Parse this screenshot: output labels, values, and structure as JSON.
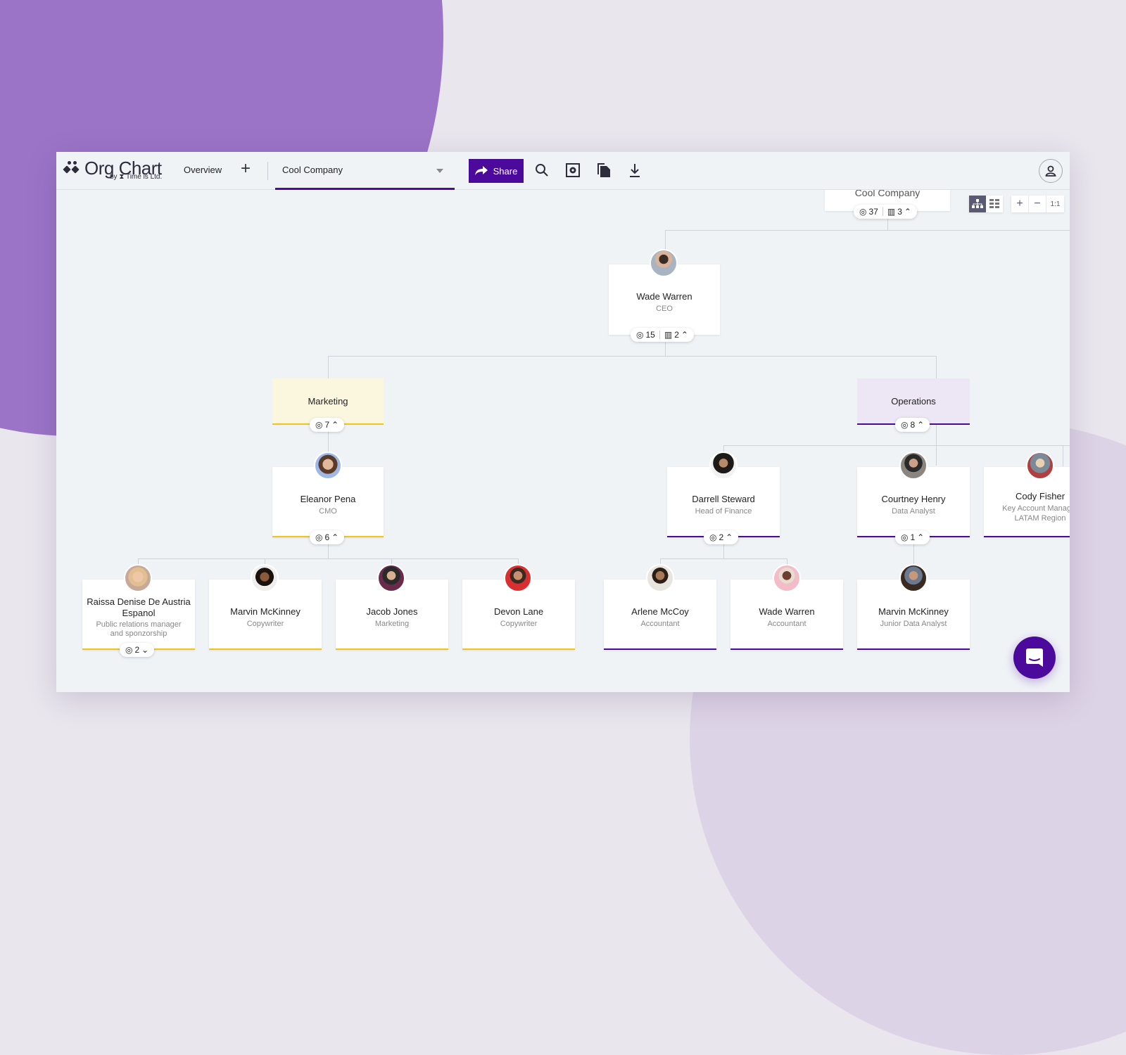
{
  "app": {
    "brand": "Org Chart",
    "brand_sub": "by ⧗ Time is Ltd.",
    "nav_overview": "Overview",
    "company_select": "Cool Company",
    "share_label": "Share",
    "zoom_reset": "1:1",
    "colors": {
      "accent": "#4b0a9c",
      "marketing": "#f0c419",
      "marketing_bg": "#fbf7df",
      "operations_bg": "#ece6f5"
    }
  },
  "root": {
    "name": "Cool Company",
    "people": "37",
    "units": "3"
  },
  "ceo": {
    "name": "Wade Warren",
    "title": "CEO",
    "people": "15",
    "units": "2"
  },
  "departments": [
    {
      "name": "Marketing",
      "people": "7"
    },
    {
      "name": "Operations",
      "people": "8"
    }
  ],
  "managers": [
    {
      "name": "Eleanor Pena",
      "title": "CMO",
      "people": "6"
    },
    {
      "name": "Darrell Steward",
      "title": "Head of Finance",
      "people": "2"
    },
    {
      "name": "Courtney Henry",
      "title": "Data Analyst",
      "people": "1"
    },
    {
      "name": "Cody Fisher",
      "title": "Key Account Manager LATAM Region"
    }
  ],
  "employees": [
    {
      "name": "Raissa Denise De Austria Espanol",
      "title": "Public relations manager and sponzorship",
      "people": "2"
    },
    {
      "name": "Marvin McKinney",
      "title": "Copywriter"
    },
    {
      "name": "Jacob Jones",
      "title": "Marketing"
    },
    {
      "name": "Devon Lane",
      "title": "Copywriter"
    },
    {
      "name": "Arlene McCoy",
      "title": "Accountant"
    },
    {
      "name": "Wade Warren",
      "title": "Accountant"
    },
    {
      "name": "Marvin McKinney",
      "title": "Junior Data Analyst"
    }
  ]
}
